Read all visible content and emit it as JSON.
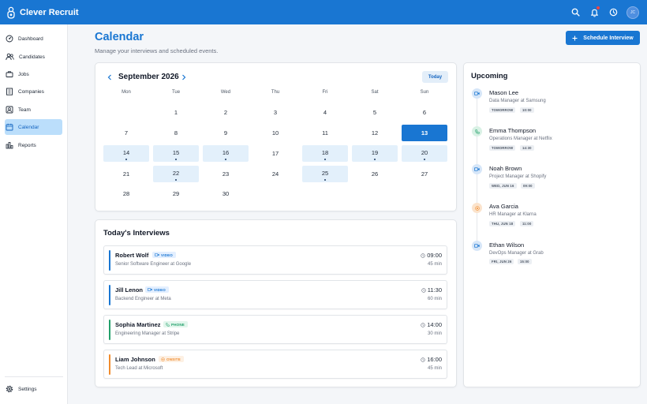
{
  "app": {
    "name": "Clever Recruit",
    "user_initials": "JC"
  },
  "sidebar": {
    "items": [
      {
        "label": "Dashboard",
        "icon": "dashboard-icon"
      },
      {
        "label": "Candidates",
        "icon": "people-icon"
      },
      {
        "label": "Jobs",
        "icon": "briefcase-icon"
      },
      {
        "label": "Companies",
        "icon": "building-icon"
      },
      {
        "label": "Team",
        "icon": "team-icon"
      },
      {
        "label": "Calendar",
        "icon": "calendar-icon",
        "active": true
      },
      {
        "label": "Reports",
        "icon": "bar-chart-icon"
      }
    ],
    "settings_label": "Settings"
  },
  "header": {
    "title": "Calendar",
    "subtitle": "Manage your interviews and scheduled events.",
    "schedule_button": "Schedule Interview"
  },
  "calendar": {
    "month_label": "September 2026",
    "today_button": "Today",
    "weekdays": [
      "Mon",
      "Tue",
      "Wed",
      "Thu",
      "Fri",
      "Sat",
      "Sun"
    ],
    "weeks": [
      [
        null,
        "1",
        "2",
        "3",
        "4",
        "5",
        "6"
      ],
      [
        "7",
        "8",
        "9",
        "10",
        "11",
        "12",
        "13"
      ],
      [
        "14",
        "15",
        "16",
        "17",
        "18",
        "19",
        "20"
      ],
      [
        "21",
        "22",
        "23",
        "24",
        "25",
        "26",
        "27"
      ],
      [
        "28",
        "29",
        "30",
        null,
        null,
        null,
        null
      ]
    ],
    "selected_day": "13",
    "event_days": [
      "14",
      "15",
      "16",
      "18",
      "19",
      "20",
      "22",
      "25"
    ]
  },
  "today": {
    "title": "Today's Interviews",
    "interviews": [
      {
        "name": "Robert Wolf",
        "type": "VIDEO",
        "role": "Senior Software Engineer at Google",
        "time": "09:00",
        "duration": "45 min",
        "color": "#1976d2"
      },
      {
        "name": "Jill Lenon",
        "type": "VIDEO",
        "role": "Backend Engineer at Meta",
        "time": "11:30",
        "duration": "60 min",
        "color": "#1976d2"
      },
      {
        "name": "Sophia Martinez",
        "type": "PHONE",
        "role": "Engineering Manager at Stripe",
        "time": "14:00",
        "duration": "30 min",
        "color": "#22a06b"
      },
      {
        "name": "Liam Johnson",
        "type": "ONSITE",
        "role": "Tech Lead at Microsoft",
        "time": "16:00",
        "duration": "45 min",
        "color": "#f08c2e"
      }
    ]
  },
  "upcoming": {
    "title": "Upcoming",
    "items": [
      {
        "name": "Mason Lee",
        "role": "Data Manager at Samsung",
        "day": "TOMORROW",
        "time": "10:00",
        "type": "video"
      },
      {
        "name": "Emma Thompson",
        "role": "Operations Manager at Netflix",
        "day": "TOMORROW",
        "time": "14:30",
        "type": "phone"
      },
      {
        "name": "Noah Brown",
        "role": "Project Manager at Shopify",
        "day": "WED, JUN 16",
        "time": "09:00",
        "type": "video"
      },
      {
        "name": "Ava Garcia",
        "role": "HR Manager at Klarna",
        "day": "THU, JUN 18",
        "time": "11:00",
        "type": "onsite"
      },
      {
        "name": "Ethan Wilson",
        "role": "DevOps Manager at Grab",
        "day": "FRI, JUN 26",
        "time": "15:00",
        "type": "video"
      }
    ]
  },
  "colors": {
    "primary": "#1976d2",
    "video": "#1976d2",
    "phone": "#22a06b",
    "onsite": "#f08c2e"
  }
}
